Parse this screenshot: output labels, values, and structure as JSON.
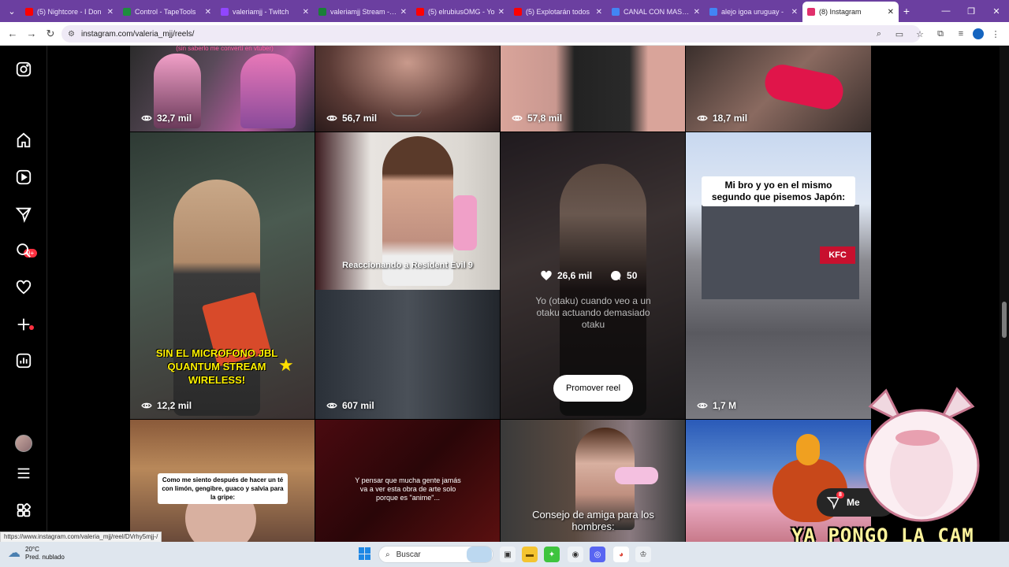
{
  "browser": {
    "tabs": [
      {
        "title": "(5) Nightcore - I Don",
        "color": "#ff0000",
        "active": false
      },
      {
        "title": "Control - TapeTools",
        "color": "#1e8e3e",
        "active": false
      },
      {
        "title": "valeriamjj - Twitch",
        "color": "#9146ff",
        "active": false
      },
      {
        "title": "valeriamjj Stream - W",
        "color": "#1a7f37",
        "active": false
      },
      {
        "title": "(5) elrubiusOMG - Yo",
        "color": "#ff0000",
        "active": false
      },
      {
        "title": "(5) Explotarán todos",
        "color": "#ff0000",
        "active": false
      },
      {
        "title": "CANAL CON MAS SU",
        "color": "#4285f4",
        "active": false
      },
      {
        "title": "alejo igoa uruguay -",
        "color": "#4285f4",
        "active": false
      },
      {
        "title": "(8) Instagram",
        "color": "#e1306c",
        "active": true
      }
    ],
    "new_tab": "+",
    "url": "instagram.com/valeria_mjj/reels/"
  },
  "sidenav": {
    "notifications_badge": "9+"
  },
  "reels": {
    "row1": [
      {
        "views": "32,7 mil",
        "caption": "(sin saberlo me convertí en vtuber)"
      },
      {
        "views": "56,7 mil"
      },
      {
        "views": "57,8 mil"
      },
      {
        "views": "18,7 mil"
      }
    ],
    "row2": [
      {
        "views": "12,2 mil",
        "caption": "SIN EL MICROFONO JBL QUANTUM STREAM WIRELESS!"
      },
      {
        "views": "607 mil",
        "caption": "Reaccionando a Resident Evil 9"
      },
      {
        "likes": "26,6 mil",
        "comments": "50",
        "caption": "Yo (otaku) cuando veo a un otaku actuando demasiado otaku",
        "promote_label": "Promover reel"
      },
      {
        "views": "1,7 M",
        "caption": "Mi bro y yo en el mismo segundo que pisemos Japón:",
        "sign": "KFC"
      }
    ],
    "row3": [
      {
        "caption": "Como me siento después de hacer un té con limón, gengibre, guaco y salvia para la gripe:"
      },
      {
        "caption": "Y pensar que mucha gente jamás va a ver esta obra de arte solo porque es \"anime\"..."
      },
      {
        "caption": "Consejo de amiga para los hombres:"
      },
      {
        "caption": ""
      }
    ]
  },
  "messages": {
    "label": "Me",
    "badge": "8",
    "more": "···"
  },
  "overlay": {
    "stream_text": "YA PONGO LA CAM"
  },
  "status_url": "https://www.instagram.com/valeria_mjj/reel/DVrhy5mjj-/",
  "taskbar": {
    "temp": "20°C",
    "weather": "Pred. nublado",
    "search_placeholder": "Buscar"
  }
}
